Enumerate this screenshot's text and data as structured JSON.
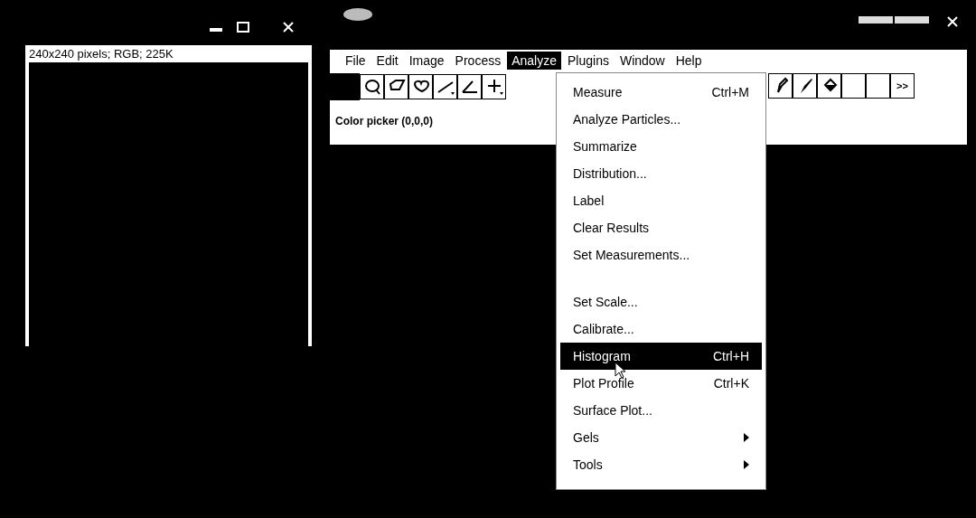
{
  "image_window": {
    "info": "240x240 pixels; RGB; 225K"
  },
  "menu_bar": [
    {
      "label": "File",
      "selected": false
    },
    {
      "label": "Edit",
      "selected": false
    },
    {
      "label": "Image",
      "selected": false
    },
    {
      "label": "Process",
      "selected": false
    },
    {
      "label": "Analyze",
      "selected": true
    },
    {
      "label": "Plugins",
      "selected": false
    },
    {
      "label": "Window",
      "selected": false
    },
    {
      "label": "Help",
      "selected": false
    }
  ],
  "toolbar": {
    "more_label": ">>"
  },
  "status": "Color picker (0,0,0)",
  "menu": [
    {
      "kind": "item",
      "label": "Measure",
      "shortcut": "Ctrl+M",
      "selected": false
    },
    {
      "kind": "item",
      "label": "Analyze Particles...",
      "selected": false
    },
    {
      "kind": "item",
      "label": "Summarize",
      "selected": false
    },
    {
      "kind": "item",
      "label": "Distribution...",
      "selected": false
    },
    {
      "kind": "item",
      "label": "Label",
      "selected": false
    },
    {
      "kind": "item",
      "label": "Clear Results",
      "selected": false
    },
    {
      "kind": "item",
      "label": "Set Measurements...",
      "selected": false
    },
    {
      "kind": "separator"
    },
    {
      "kind": "item",
      "label": "Set Scale...",
      "selected": false
    },
    {
      "kind": "item",
      "label": "Calibrate...",
      "selected": false
    },
    {
      "kind": "item",
      "label": "Histogram",
      "shortcut": "Ctrl+H",
      "selected": true
    },
    {
      "kind": "item",
      "label": "Plot Profile",
      "shortcut": "Ctrl+K",
      "selected": false
    },
    {
      "kind": "item",
      "label": "Surface Plot...",
      "selected": false
    },
    {
      "kind": "submenu",
      "label": "Gels",
      "selected": false
    },
    {
      "kind": "submenu",
      "label": "Tools",
      "selected": false
    }
  ]
}
